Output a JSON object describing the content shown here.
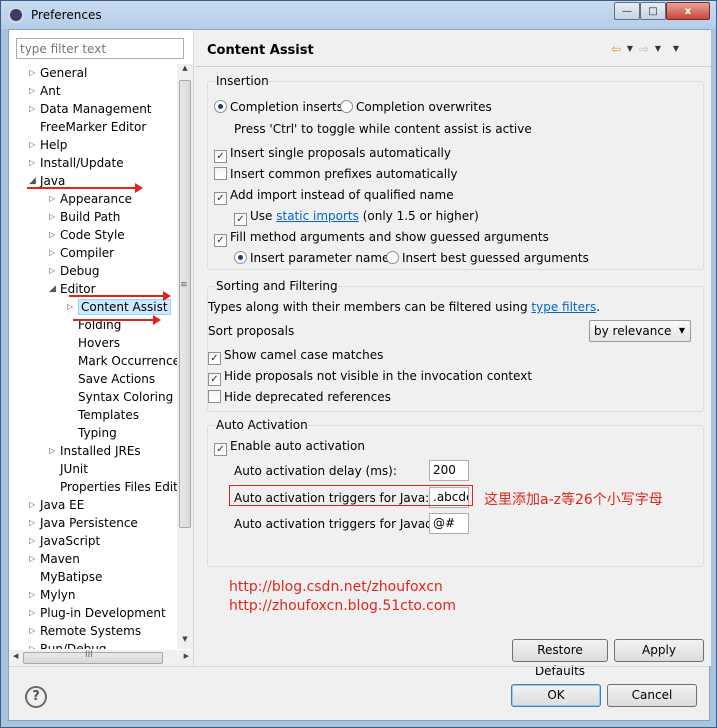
{
  "window": {
    "title": "Preferences",
    "minimize": "—",
    "maximize": "□",
    "close": "x"
  },
  "filter": {
    "placeholder": "type filter text"
  },
  "tree": [
    {
      "label": "General",
      "twisty": "▷"
    },
    {
      "label": "Ant",
      "twisty": "▷"
    },
    {
      "label": "Data Management",
      "twisty": "▷"
    },
    {
      "label": "FreeMarker Editor",
      "twisty": ""
    },
    {
      "label": "Help",
      "twisty": "▷"
    },
    {
      "label": "Install/Update",
      "twisty": "▷"
    },
    {
      "label": "Java",
      "twisty": "◢"
    },
    {
      "label": "Appearance",
      "twisty": "▷"
    },
    {
      "label": "Build Path",
      "twisty": "▷"
    },
    {
      "label": "Code Style",
      "twisty": "▷"
    },
    {
      "label": "Compiler",
      "twisty": "▷"
    },
    {
      "label": "Debug",
      "twisty": "▷"
    },
    {
      "label": "Editor",
      "twisty": "◢"
    },
    {
      "label": "Content Assist",
      "twisty": "▷"
    },
    {
      "label": "Folding",
      "twisty": ""
    },
    {
      "label": "Hovers",
      "twisty": ""
    },
    {
      "label": "Mark Occurrences",
      "twisty": ""
    },
    {
      "label": "Save Actions",
      "twisty": ""
    },
    {
      "label": "Syntax Coloring",
      "twisty": ""
    },
    {
      "label": "Templates",
      "twisty": ""
    },
    {
      "label": "Typing",
      "twisty": ""
    },
    {
      "label": "Installed JREs",
      "twisty": "▷"
    },
    {
      "label": "JUnit",
      "twisty": ""
    },
    {
      "label": "Properties Files Editor",
      "twisty": ""
    },
    {
      "label": "Java EE",
      "twisty": "▷"
    },
    {
      "label": "Java Persistence",
      "twisty": "▷"
    },
    {
      "label": "JavaScript",
      "twisty": "▷"
    },
    {
      "label": "Maven",
      "twisty": "▷"
    },
    {
      "label": "MyBatipse",
      "twisty": ""
    },
    {
      "label": "Mylyn",
      "twisty": "▷"
    },
    {
      "label": "Plug-in Development",
      "twisty": "▷"
    },
    {
      "label": "Remote Systems",
      "twisty": "▷"
    },
    {
      "label": "Run/Debug",
      "twisty": "▷"
    }
  ],
  "page": {
    "title": "Content Assist",
    "insertion": {
      "title": "Insertion",
      "completion_inserts": "Completion inserts",
      "completion_overwrites": "Completion overwrites",
      "toggle_hint": "Press 'Ctrl' to toggle while content assist is active",
      "insert_single": "Insert single proposals automatically",
      "insert_common": "Insert common prefixes automatically",
      "add_import": "Add import instead of qualified name",
      "use": "Use",
      "static_imports": "static imports",
      "only_15": "(only 1.5 or higher)",
      "fill_method": "Fill method arguments and show guessed arguments",
      "insert_param": "Insert parameter names",
      "insert_best": "Insert best guessed arguments"
    },
    "sorting": {
      "title": "Sorting and Filtering",
      "types_text": "Types along with their members can be filtered using",
      "type_filters": "type filters",
      "period": ".",
      "sort_label": "Sort proposals",
      "sort_value": "by relevance",
      "show_camel": "Show camel case matches",
      "hide_invisible": "Hide proposals not visible in the invocation context",
      "hide_deprecated": "Hide deprecated references"
    },
    "auto": {
      "title": "Auto Activation",
      "enable": "Enable auto activation",
      "delay_label": "Auto activation delay (ms):",
      "delay_value": "200",
      "java_label": "Auto activation triggers for Java:",
      "java_value": ".abcde",
      "javadoc_label": "Auto activation triggers for Javadoc:",
      "javadoc_value": "@#"
    },
    "annotation": "这里添加a-z等26个小写字母",
    "urls": [
      "http://blog.csdn.net/zhoufoxcn",
      "http://zhoufoxcn.blog.51cto.com"
    ],
    "restore_defaults": "Restore Defaults",
    "apply": "Apply"
  },
  "dialog": {
    "help": "?",
    "ok": "OK",
    "cancel": "Cancel"
  },
  "scroll": {
    "grip": "≡",
    "hgrip": "III"
  },
  "colors": {
    "annotation_red": "#e0261b",
    "link_blue": "#0066cc",
    "selection": "#cde8ff"
  },
  "icons": {
    "back": "⇦",
    "forward": "⇨",
    "dropdown": "▼",
    "menu": "▼"
  }
}
